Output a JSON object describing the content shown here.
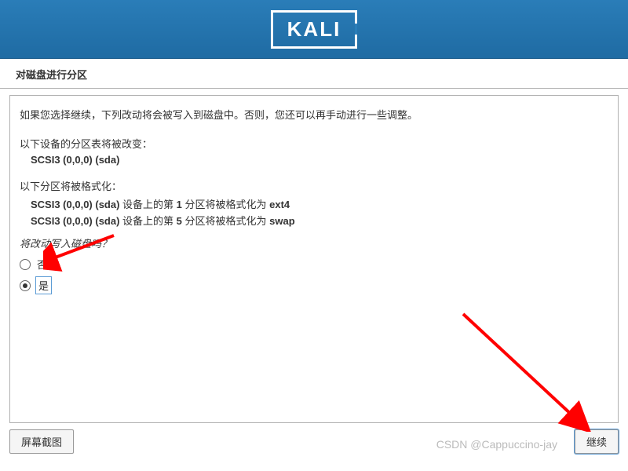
{
  "logo": "KALI",
  "title": "对磁盘进行分区",
  "intro": "如果您选择继续，下列改动将会被写入到磁盘中。否则，您还可以再手动进行一些调整。",
  "partition_table_label": "以下设备的分区表将被改变：",
  "partition_table_devices": [
    "SCSI3 (0,0,0) (sda)"
  ],
  "format_label": "以下分区将被格式化：",
  "format_lines": [
    {
      "prefix": "SCSI3 (0,0,0) (sda) ",
      "mid": "设备上的第 ",
      "num": "1",
      "tail": " 分区将被格式化为 ",
      "fs": "ext4"
    },
    {
      "prefix": "SCSI3 (0,0,0) (sda) ",
      "mid": "设备上的第 ",
      "num": "5",
      "tail": " 分区将被格式化为 ",
      "fs": "swap"
    }
  ],
  "question": "将改动写入磁盘吗？",
  "options": {
    "no": "否",
    "yes": "是"
  },
  "selected": "yes",
  "buttons": {
    "screenshot": "屏幕截图",
    "continue": "继续"
  },
  "watermark": "CSDN @Cappuccino-jay"
}
